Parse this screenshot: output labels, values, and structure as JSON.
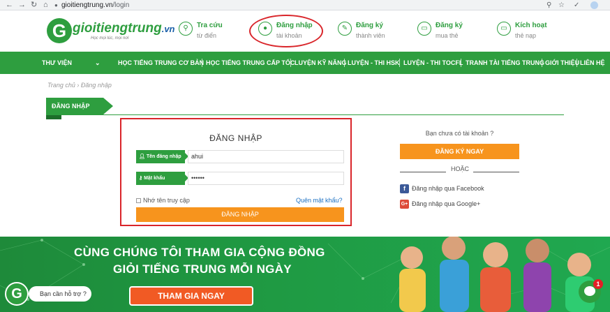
{
  "browser": {
    "url_domain": "gioitiengtrung.vn",
    "url_path": "/login"
  },
  "header": {
    "logo": {
      "brand": "gioitiengtrung",
      "tld": ".vn",
      "slogan": "Học mọi lúc, mọi nơi"
    },
    "items": [
      {
        "line1": "Tra cứu",
        "line2": "từ điển",
        "icon": "search-icon"
      },
      {
        "line1": "Đăng nhập",
        "line2": "tài khoản",
        "icon": "user-icon"
      },
      {
        "line1": "Đăng ký",
        "line2": "thành viên",
        "icon": "edit-icon"
      },
      {
        "line1": "Đăng ký",
        "line2": "mua thẻ",
        "icon": "card-icon"
      },
      {
        "line1": "Kích hoạt",
        "line2": "thẻ nạp",
        "icon": "card-icon"
      }
    ]
  },
  "nav": {
    "items": [
      "THƯ VIỆN",
      "HỌC TIẾNG TRUNG CƠ BẢN",
      "HỌC TIẾNG TRUNG CẤP TỐC",
      "LUYỆN KỸ NĂNG",
      "LUYỆN - THI HSK",
      "LUYỆN - THI TOCFL",
      "TRANH TÀI TIẾNG TRUNG",
      "GIỚI THIỆU",
      "LIÊN HỆ"
    ]
  },
  "breadcrumb": "Trang chủ › Đăng nhập",
  "section_title": "ĐĂNG NHẬP",
  "login": {
    "title": "ĐĂNG NHẬP",
    "username_label": "Tên đăng nhập",
    "username_value": "ahui",
    "password_label": "Mật khẩu",
    "password_value": "••••••",
    "remember_label": "Nhớ tên truy cập",
    "forgot_label": "Quên mật khẩu?",
    "submit_label": "ĐĂNG NHẬP"
  },
  "register": {
    "prompt": "Bạn chưa có tài khoản ?",
    "button_label": "ĐĂNG KÝ NGAY",
    "or_label": "HOẶC",
    "facebook_label": "Đăng nhập qua Facebook",
    "google_label": "Đăng nhập qua Google+"
  },
  "banner": {
    "line1": "CÙNG CHÚNG TÔI THAM GIA CỘNG ĐỒNG",
    "line2": "GIỎI TIẾNG TRUNG MỖI NGÀY",
    "button_label": "THAM GIA NGAY"
  },
  "help": {
    "text": "Bạn cần hỗ trợ ?"
  },
  "chat": {
    "badge_count": "1"
  },
  "colors": {
    "brand_green": "#2e9e3f",
    "accent_orange": "#f7941d",
    "highlight_red": "#d9252a",
    "link_blue": "#1a6fc2"
  }
}
